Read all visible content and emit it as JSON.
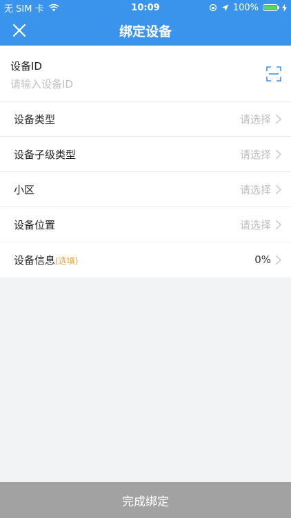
{
  "status_bar": {
    "carrier": "无 SIM 卡",
    "time": "10:09",
    "battery": "100%"
  },
  "nav": {
    "title": "绑定设备",
    "close_icon": "close-icon"
  },
  "device_id": {
    "label": "设备ID",
    "placeholder": "请输入设备ID",
    "value": "",
    "scan_icon": "scan-icon"
  },
  "rows": [
    {
      "label": "设备类型",
      "value": "请选择"
    },
    {
      "label": "设备子级类型",
      "value": "请选择"
    },
    {
      "label": "小区",
      "value": "请选择"
    },
    {
      "label": "设备位置",
      "value": "请选择"
    },
    {
      "label": "设备信息",
      "optional": "(选填)",
      "value": "0%"
    }
  ],
  "submit_label": "完成绑定",
  "colors": {
    "header": "#3a94ec",
    "optional": "#f0a030",
    "submit_bg": "#a2a2a2"
  }
}
